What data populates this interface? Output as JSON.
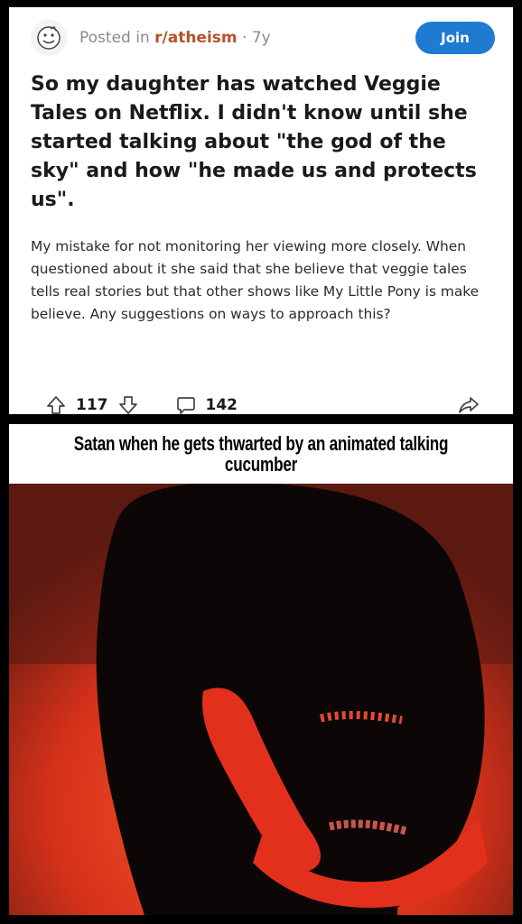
{
  "post": {
    "posted_prefix": "Posted in ",
    "subreddit": "r/atheism",
    "age": " · 7y",
    "join_label": "Join",
    "title": "So my daughter has watched Veggie Tales on Netflix. I didn't know until she started talking about \"the god of the sky\" and how \"he made us and protects us\".",
    "body": "My mistake for not monitoring her viewing more closely. When questioned about it she said that she believe that veggie tales tells real stories but that other shows like My Little Pony is make believe. Any suggestions on ways to approach this?",
    "upvotes": "117",
    "comments": "142",
    "icons": {
      "subreddit": "atheism-icon",
      "upvote": "arrow-up-icon",
      "downvote": "arrow-down-icon",
      "comment": "comment-icon",
      "share": "share-icon"
    },
    "colors": {
      "join": "#1f7ad1",
      "subreddit": "#b4532a"
    }
  },
  "meme": {
    "caption": "Satan when he gets thwarted by an animated talking cucumber",
    "colors": {
      "background": "#e23a1e",
      "figure": "#0a0505"
    }
  }
}
